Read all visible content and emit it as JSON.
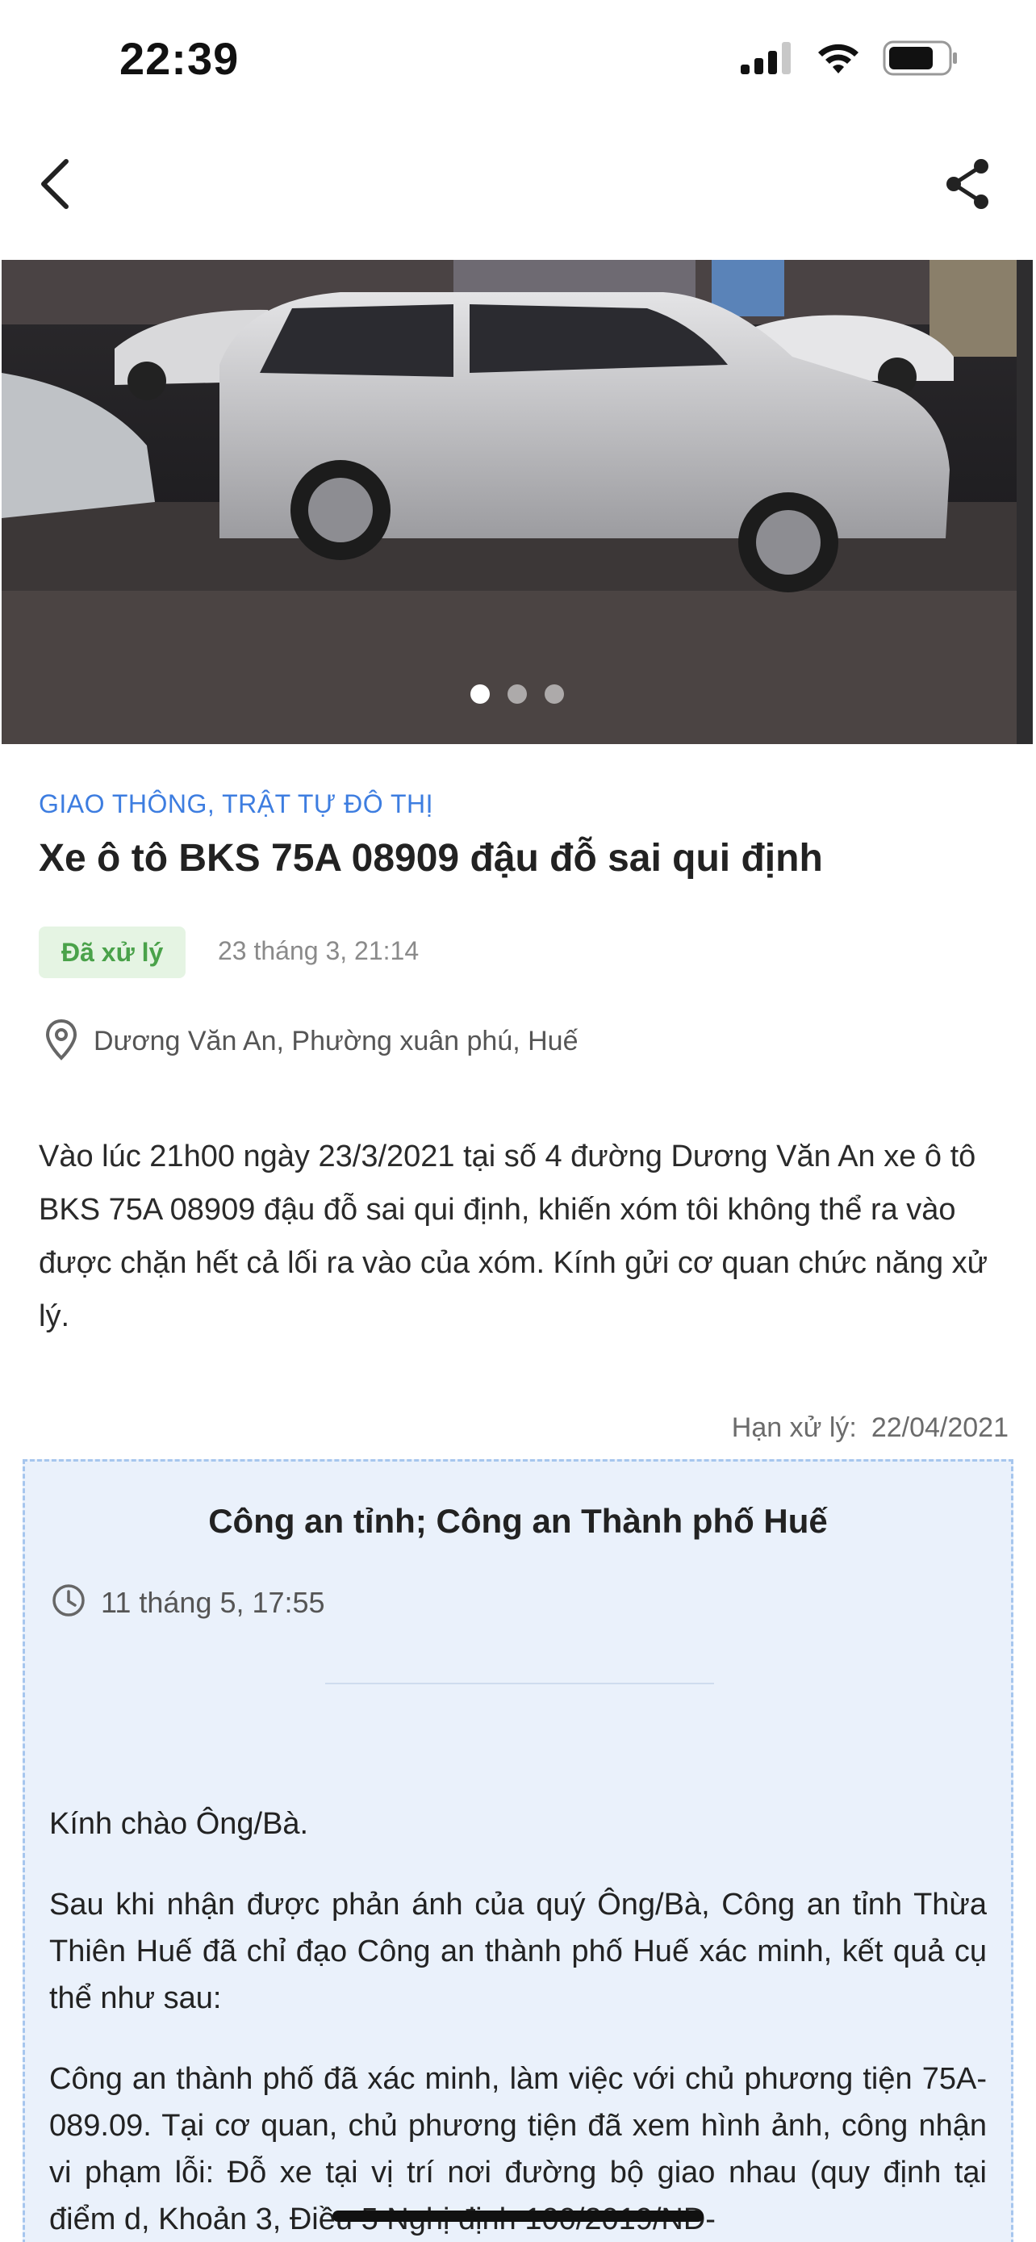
{
  "status_bar": {
    "time": "22:39",
    "icons": [
      "signal-icon",
      "wifi-icon",
      "battery-icon"
    ]
  },
  "nav": {
    "back_icon": "chevron-left-icon",
    "share_icon": "share-icon"
  },
  "gallery": {
    "image_count": 3,
    "active_index": 0
  },
  "report": {
    "category": "GIAO THÔNG, TRẬT TỰ ĐÔ THỊ",
    "title": "Xe ô tô BKS 75A 08909 đậu đỗ sai qui định",
    "status": "Đã xử lý",
    "date": "23 tháng 3, 21:14",
    "location": "Dương Văn An, Phường xuân phú, Huế",
    "description": "Vào lúc 21h00 ngày 23/3/2021 tại số 4 đường Dương Văn An xe ô tô BKS 75A 08909 đậu đỗ sai qui định, khiến xóm tôi không thể ra vào được chặn hết cả lối ra vào của xóm. Kính gửi cơ quan chức năng xử lý.",
    "deadline_label": "Hạn xử lý:",
    "deadline_value": "22/04/2021"
  },
  "response": {
    "organization": "Công an tỉnh; Công an Thành phố Huế",
    "time": "11 tháng 5, 17:55",
    "paragraphs": [
      "Kính chào Ông/Bà.",
      " Sau khi nhận được phản ánh của quý Ông/Bà, Công an tỉnh Thừa Thiên Huế đã chỉ đạo Công an thành phố Huế xác minh, kết quả cụ thể như sau:",
      " Công an thành phố đã xác minh, làm việc với chủ phương tiện 75A-089.09. Tại cơ quan, chủ phương tiện đã xem hình ảnh, công nhận vi phạm lỗi: Đỗ xe tại vị trí nơi đường bộ giao nhau (quy định tại điểm d, Khoản 3, Điều 5 Nghị định 100/2019/NĐ-"
    ]
  },
  "colors": {
    "accent": "#3d7de0",
    "status_bg": "#e5f4e3",
    "status_text": "#4aa24a",
    "response_bg": "#eaf1fb",
    "response_border": "#a6c6ee"
  }
}
